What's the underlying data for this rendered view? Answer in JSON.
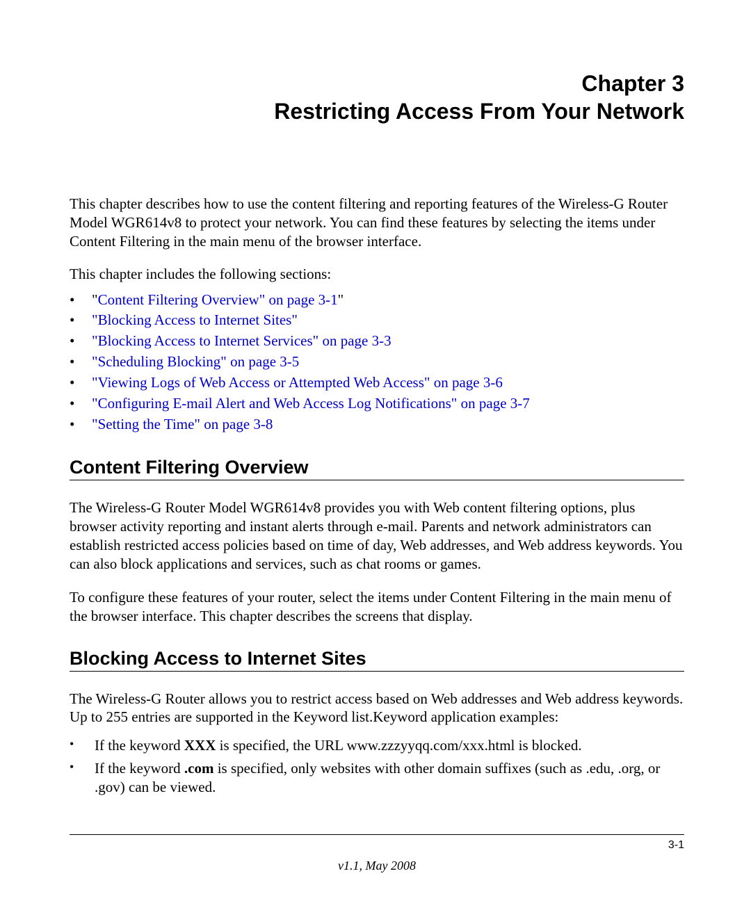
{
  "chapter": {
    "num_line": "Chapter 3",
    "title": "Restricting Access From Your Network"
  },
  "intro": "This chapter describes how to use the content filtering and reporting features of the Wireless-G Router Model WGR614v8 to protect your network. You can find these features by selecting the items under Content Filtering in the main menu of the browser interface.",
  "sections_intro": "This chapter includes the following sections:",
  "toc": [
    {
      "prefix": "\"",
      "link": "Content Filtering Overview\" on page 3-1",
      "suffix": "\""
    },
    {
      "prefix": "",
      "link": "\"Blocking Access to Internet Sites\"",
      "suffix": ""
    },
    {
      "prefix": "",
      "link": "\"Blocking Access to Internet Services\" on page 3-3",
      "suffix": ""
    },
    {
      "prefix": "",
      "link": "\"Scheduling Blocking\" on page 3-5",
      "suffix": ""
    },
    {
      "prefix": "",
      "link": "\"Viewing Logs of Web Access or Attempted Web Access\" on page 3-6",
      "suffix": ""
    },
    {
      "prefix": "",
      "link": "\"Configuring E-mail Alert and Web Access Log Notifications\" on page 3-7",
      "suffix": ""
    },
    {
      "prefix": "",
      "link": "\"Setting the Time\" on page 3-8",
      "suffix": ""
    }
  ],
  "section1": {
    "heading": "Content Filtering Overview",
    "p1": "The Wireless-G Router Model WGR614v8 provides you with Web content filtering options, plus browser activity reporting and instant alerts through e-mail. Parents and network administrators can establish restricted access policies based on time of day, Web addresses, and Web address keywords. You can also block applications and services, such as chat rooms or games.",
    "p2": "To configure these features of your router, select the items under Content Filtering in the main menu of the browser interface. This chapter describes the screens that display."
  },
  "section2": {
    "heading": "Blocking Access to Internet Sites",
    "p1": "The Wireless-G Router allows you to restrict access based on Web addresses and Web address keywords. Up to 255 entries are supported in the Keyword list.Keyword application examples:",
    "ex1_a": "If the keyword ",
    "ex1_bold": "XXX",
    "ex1_b": " is specified, the URL www.zzzyyqq.com/xxx.html is blocked.",
    "ex2_a": "If the keyword ",
    "ex2_bold": ".com",
    "ex2_b": " is specified, only websites with other domain suffixes (such as .edu, .org, or .gov) can be viewed."
  },
  "footer": {
    "page_num": "3-1",
    "version": "v1.1, May 2008"
  }
}
